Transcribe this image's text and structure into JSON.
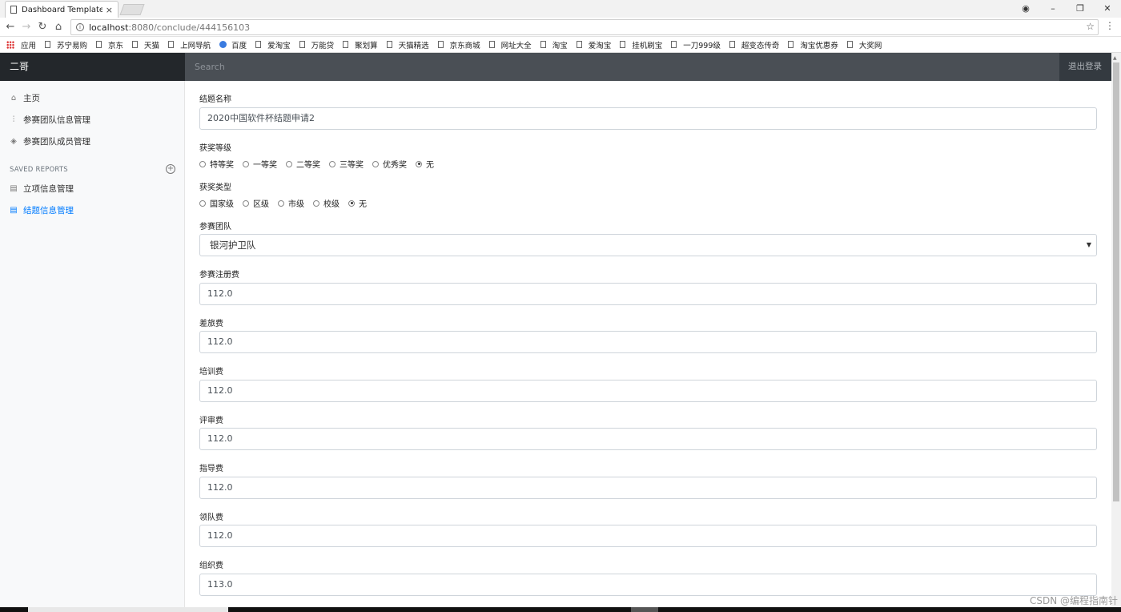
{
  "browser": {
    "tab_title": "Dashboard Template fo",
    "tab_close": "×",
    "url_host": "localhost",
    "url_rest": ":8080/conclude/444156103",
    "bookmarks": [
      "应用",
      "苏宁易购",
      "京东",
      "天猫",
      "上网导航",
      "百度",
      "爱淘宝",
      "万能贷",
      "聚划算",
      "天猫精选",
      "京东商城",
      "网址大全",
      "淘宝",
      "爱淘宝",
      "挂机刷宝",
      "一刀999级",
      "超变态传奇",
      "淘宝优惠券",
      "大奖网"
    ]
  },
  "navbar": {
    "brand": "二哥",
    "search_placeholder": "Search",
    "signout": "退出登录"
  },
  "sidebar": {
    "items": [
      {
        "label": "主页",
        "icon": "home-icon"
      },
      {
        "label": "参赛团队信息管理",
        "icon": "bar-chart-icon"
      },
      {
        "label": "参赛团队成员管理",
        "icon": "layers-icon"
      }
    ],
    "saved_heading": "SAVED REPORTS",
    "reports": [
      {
        "label": "立项信息管理",
        "icon": "file-icon"
      },
      {
        "label": "结题信息管理",
        "icon": "file-icon"
      }
    ],
    "active_color": "#007bff"
  },
  "form": {
    "title_label": "结题名称",
    "title_value": "2020中国软件杯结题申请2",
    "award_level_label": "获奖等级",
    "award_levels": [
      "特等奖",
      "一等奖",
      "二等奖",
      "三等奖",
      "优秀奖",
      "无"
    ],
    "award_level_selected": "无",
    "award_type_label": "获奖类型",
    "award_types": [
      "国家级",
      "区级",
      "市级",
      "校级",
      "无"
    ],
    "award_type_selected": "无",
    "team_label": "参赛团队",
    "team_value": "银河护卫队",
    "fees": [
      {
        "label": "参赛注册费",
        "value": "112.0"
      },
      {
        "label": "差旅费",
        "value": "112.0"
      },
      {
        "label": "培训费",
        "value": "112.0"
      },
      {
        "label": "评审费",
        "value": "112.0"
      },
      {
        "label": "指导费",
        "value": "112.0"
      },
      {
        "label": "领队费",
        "value": "112.0"
      },
      {
        "label": "组织费",
        "value": "113.0"
      }
    ]
  },
  "watermark": "CSDN @编程指南针"
}
